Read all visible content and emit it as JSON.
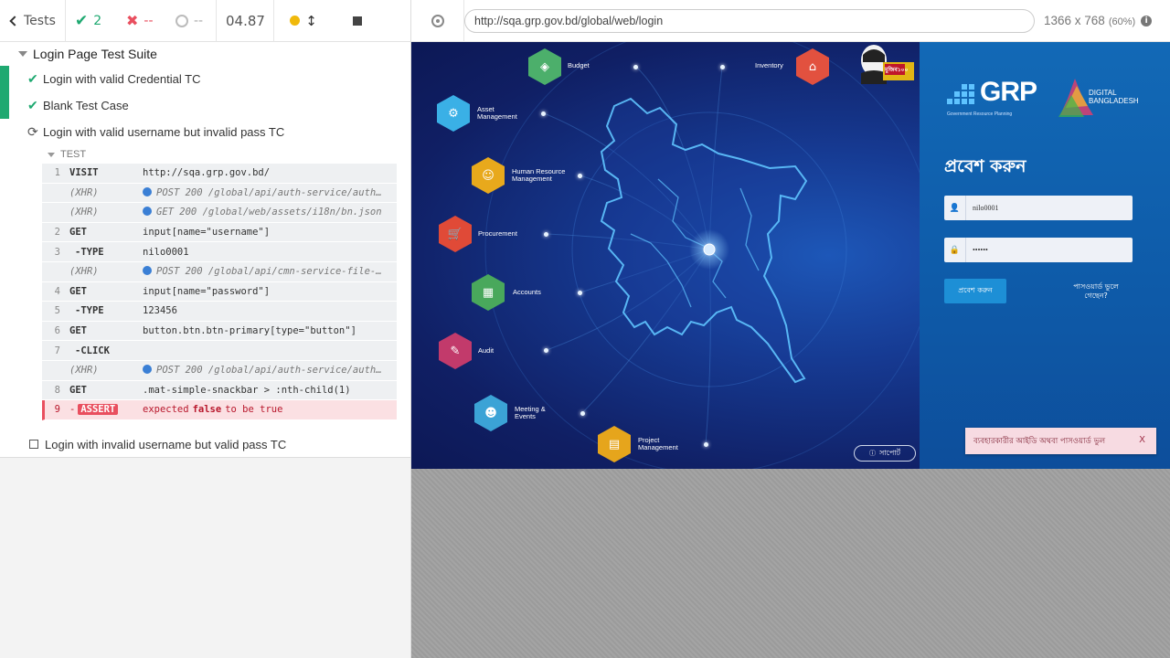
{
  "reporter": {
    "back_label": "Tests",
    "passed": "2",
    "failed": "--",
    "pending": "--",
    "duration": "04.87"
  },
  "suite": {
    "title": "Login Page Test Suite",
    "tests": [
      {
        "label": "Login with valid Credential TC",
        "state": "passed"
      },
      {
        "label": "Blank Test Case",
        "state": "passed"
      },
      {
        "label": "Login with valid username but invalid pass TC",
        "state": "running"
      },
      {
        "label": "Login with invalid username but valid pass TC",
        "state": "pending"
      }
    ],
    "section_label": "TEST",
    "commands": [
      {
        "num": "1",
        "name": "VISIT",
        "msg": "http://sqa.grp.gov.bd/"
      },
      {
        "num": "",
        "name": "(XHR)",
        "msg": "POST 200 /global/api/auth-service/auth…"
      },
      {
        "num": "",
        "name": "(XHR)",
        "msg": "GET 200 /global/web/assets/i18n/bn.json"
      },
      {
        "num": "2",
        "name": "GET",
        "msg": "input[name=\"username\"]"
      },
      {
        "num": "3",
        "name": "-TYPE",
        "msg": "nilo0001"
      },
      {
        "num": "",
        "name": "(XHR)",
        "msg": "POST 200 /global/api/cmn-service-file-…"
      },
      {
        "num": "4",
        "name": "GET",
        "msg": "input[name=\"password\"]"
      },
      {
        "num": "5",
        "name": "-TYPE",
        "msg": "123456"
      },
      {
        "num": "6",
        "name": "GET",
        "msg": "button.btn.btn-primary[type=\"button\"]"
      },
      {
        "num": "7",
        "name": "-CLICK",
        "msg": ""
      },
      {
        "num": "",
        "name": "(XHR)",
        "msg": "POST 200 /global/api/auth-service/auth…"
      },
      {
        "num": "8",
        "name": "GET",
        "msg": ".mat-simple-snackbar > :nth-child(1)"
      }
    ],
    "assert": {
      "num": "9",
      "dash": "-",
      "name": "ASSERT",
      "pre": "expected",
      "value": "false",
      "post": "to be true"
    }
  },
  "aut": {
    "url": "http://sqa.grp.gov.bd/global/web/login",
    "viewport": "1366 x 768",
    "scale": "(60%)"
  },
  "app": {
    "modules": [
      {
        "label": "Budget",
        "color": "#4caf6b",
        "icon": "budget-icon"
      },
      {
        "label": "Inventory",
        "color": "#e2513f",
        "icon": "inventory-icon"
      },
      {
        "label": "Asset\nManagement",
        "color": "#3ab0e6",
        "icon": "asset-icon"
      },
      {
        "label": "Human Resource\nManagement",
        "color": "#e8a91c",
        "icon": "hr-icon"
      },
      {
        "label": "Procurement",
        "color": "#e04a37",
        "icon": "procurement-icon"
      },
      {
        "label": "Accounts",
        "color": "#49a85c",
        "icon": "accounts-icon"
      },
      {
        "label": "Audit",
        "color": "#c23a6b",
        "icon": "audit-icon"
      },
      {
        "label": "Meeting &\nEvents",
        "color": "#3ba3d6",
        "icon": "meeting-icon"
      },
      {
        "label": "Project\nManagement",
        "color": "#e6a51c",
        "icon": "project-icon"
      }
    ],
    "grp_logo": "GRP",
    "grp_sub": "Government Resource Planning",
    "db_logo": "DIGITAL\nBANGLADESH",
    "login_title": "প্রবেশ করুন",
    "username_value": "nilo0001",
    "password_value": "••••••",
    "login_button": "প্রবেশ করুন",
    "forgot_link": "পাসওয়ার্ড ভুলে গেছেন?",
    "support_button": "সাপোর্ট",
    "snackbar_message": "ব্যবহারকারীর আইডি অথবা পাসওয়ার্ড ভুল",
    "snackbar_close": "X",
    "portrait_badge": "মুজিব১০০"
  }
}
